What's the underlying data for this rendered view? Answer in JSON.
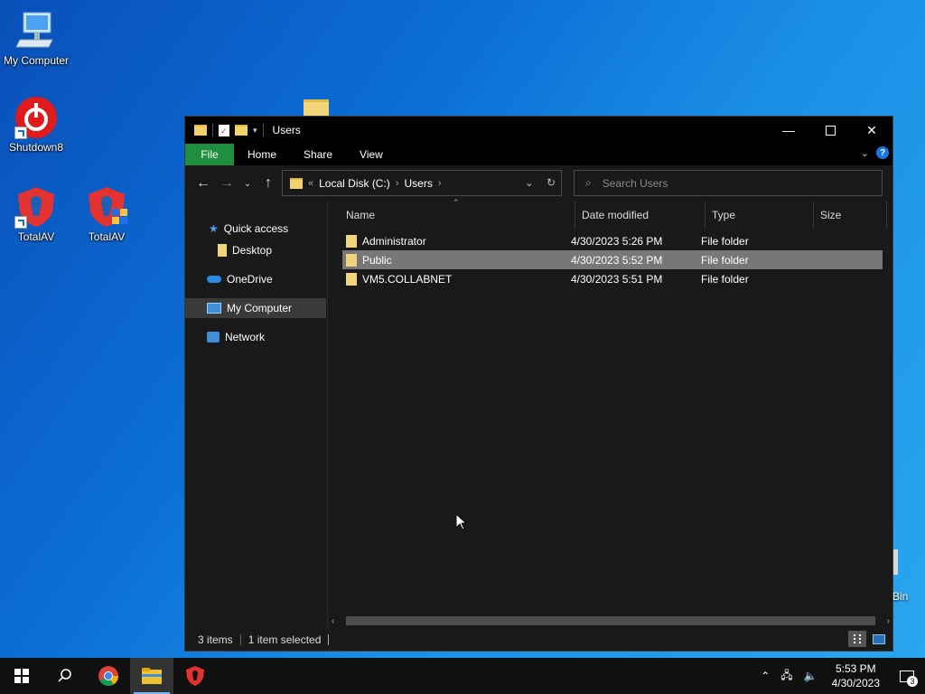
{
  "desktop": {
    "icons": [
      {
        "label": "My Computer"
      },
      {
        "label": "Shutdown8"
      },
      {
        "label": "TotalAV"
      },
      {
        "label": "TotalAV"
      }
    ],
    "partial_label": "Bin"
  },
  "window": {
    "title": "Users",
    "ribbon_tabs": [
      "File",
      "Home",
      "Share",
      "View"
    ],
    "help": "?",
    "address": {
      "root_marker": "«",
      "crumbs": [
        "Local Disk (C:)",
        "Users"
      ]
    },
    "search_placeholder": "Search Users",
    "sidebar": [
      {
        "label": "Quick access",
        "icon": "star-icon"
      },
      {
        "label": "Desktop",
        "icon": "folder-icon"
      },
      {
        "label": "OneDrive",
        "icon": "cloud-icon"
      },
      {
        "label": "My Computer",
        "icon": "computer-icon",
        "selected": true
      },
      {
        "label": "Network",
        "icon": "network-icon"
      }
    ],
    "columns": [
      "Name",
      "Date modified",
      "Type",
      "Size"
    ],
    "rows": [
      {
        "name": "Administrator",
        "date": "4/30/2023 5:26 PM",
        "type": "File folder",
        "size": ""
      },
      {
        "name": "Public",
        "date": "4/30/2023 5:52 PM",
        "type": "File folder",
        "size": "",
        "selected": true
      },
      {
        "name": "VM5.COLLABNET",
        "date": "4/30/2023 5:51 PM",
        "type": "File folder",
        "size": ""
      }
    ],
    "status": {
      "items": "3 items",
      "selected": "1 item selected"
    }
  },
  "taskbar": {
    "time": "5:53 PM",
    "date": "4/30/2023",
    "notifications": "3"
  },
  "colors": {
    "file_tab": "#1e8f3e",
    "selection": "#777777",
    "accent": "#1a73e8"
  }
}
